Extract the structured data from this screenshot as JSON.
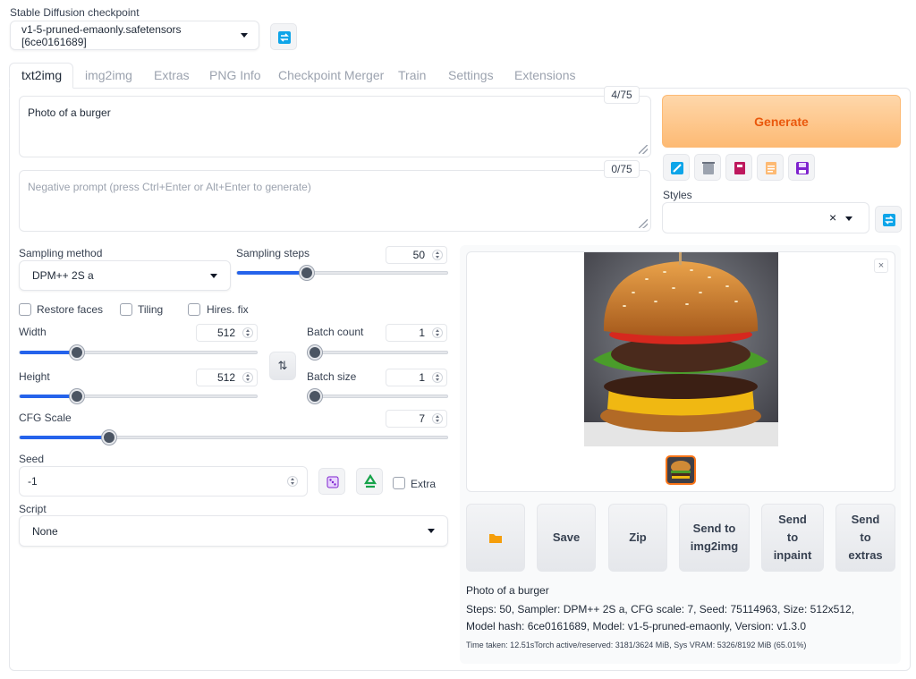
{
  "checkpoint": {
    "label": "Stable Diffusion checkpoint",
    "value": "v1-5-pruned-emaonly.safetensors [6ce0161689]",
    "refresh_icon": "refresh-icon"
  },
  "tabs": [
    "txt2img",
    "img2img",
    "Extras",
    "PNG Info",
    "Checkpoint Merger",
    "Train",
    "Settings",
    "Extensions"
  ],
  "prompt": {
    "value": "Photo of a burger",
    "counter": "4/75"
  },
  "negative_prompt": {
    "placeholder": "Negative prompt (press Ctrl+Enter or Alt+Enter to generate)",
    "counter": "0/75"
  },
  "generate": {
    "label": "Generate",
    "color": "#f97316"
  },
  "tool_icons": [
    "paint-icon",
    "trash-icon",
    "style-book-icon",
    "clipboard-icon",
    "save-icon"
  ],
  "styles": {
    "label": "Styles",
    "value": ""
  },
  "sampling": {
    "method_label": "Sampling method",
    "method_value": "DPM++ 2S a",
    "steps_label": "Sampling steps",
    "steps_value": "50",
    "steps_fraction": 0.33
  },
  "checkboxes": {
    "restore_faces": "Restore faces",
    "tiling": "Tiling",
    "hires_fix": "Hires. fix",
    "extra": "Extra"
  },
  "width": {
    "label": "Width",
    "value": "512",
    "fraction": 0.24
  },
  "height": {
    "label": "Height",
    "value": "512",
    "fraction": 0.24
  },
  "batch_count": {
    "label": "Batch count",
    "value": "1",
    "fraction": 0.0
  },
  "batch_size": {
    "label": "Batch size",
    "value": "1",
    "fraction": 0.0
  },
  "cfg": {
    "label": "CFG Scale",
    "value": "7",
    "fraction": 0.21
  },
  "seed": {
    "label": "Seed",
    "value": "-1"
  },
  "script": {
    "label": "Script",
    "value": "None"
  },
  "output": {
    "buttons": {
      "folder_icon": "folder-icon",
      "save": "Save",
      "zip": "Zip",
      "send_img2img": "Send to img2img",
      "send_inpaint": "Send to inpaint",
      "send_extras": "Send to extras"
    },
    "info_prompt": "Photo of a burger",
    "info_params": "Steps: 50, Sampler: DPM++ 2S a, CFG scale: 7, Seed: 75114963, Size: 512x512, Model hash: 6ce0161689, Model: v1-5-pruned-emaonly, Version: v1.3.0",
    "info_time": "Time taken: 12.51sTorch active/reserved: 3181/3624 MiB, Sys VRAM: 5326/8192 MiB (65.01%)"
  },
  "colors": {
    "accent": "#2563eb",
    "generate_bg": "#fdba74"
  }
}
